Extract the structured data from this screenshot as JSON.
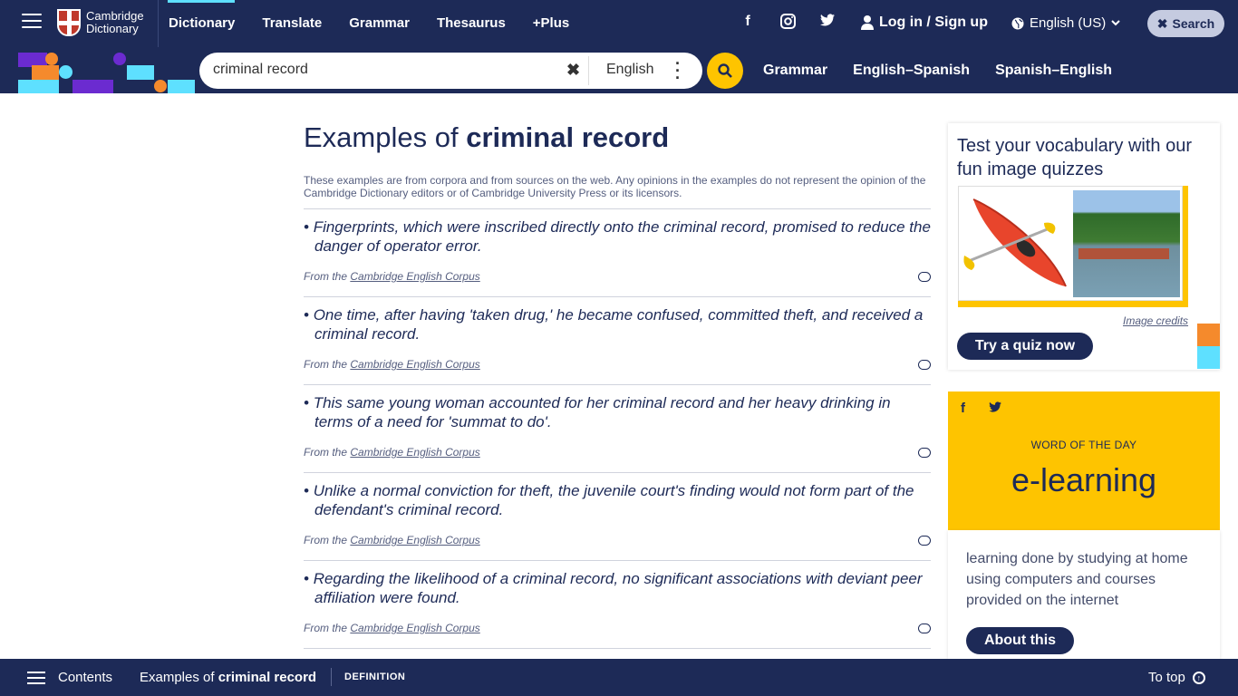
{
  "header": {
    "logo_line1": "Cambridge",
    "logo_line2": "Dictionary",
    "nav": [
      "Dictionary",
      "Translate",
      "Grammar",
      "Thesaurus",
      "+Plus"
    ],
    "login_label": "Log in / Sign up",
    "language_label": "English (US)",
    "search_label": "Search"
  },
  "searchbar": {
    "query": "criminal record",
    "dictionary_lang": "English",
    "subnav": [
      "Grammar",
      "English–Spanish",
      "Spanish–English"
    ]
  },
  "main": {
    "title_prefix": "Examples of",
    "title_term": "criminal record",
    "intro": "These examples are from corpora and from sources on the web. Any opinions in the examples do not represent the opinion of the Cambridge Dictionary editors or of Cambridge University Press or its licensors.",
    "source_prefix": "From the",
    "source_name": "Cambridge English Corpus",
    "examples": [
      "Fingerprints, which were inscribed directly onto the criminal record, promised to reduce the danger of operator error.",
      "One time, after having 'taken drug,' he became confused, committed theft, and received a criminal record.",
      "This same young woman accounted for her criminal record and her heavy drinking in terms of a need for 'summat to do'.",
      "Unlike a normal conviction for theft, the juvenile court's finding would not form part of the defendant's criminal record.",
      "Regarding the likelihood of a criminal record, no significant associations with deviant peer affiliation were found."
    ]
  },
  "quiz": {
    "title": "Test your vocabulary with our fun image quizzes",
    "credits": "Image credits",
    "button": "Try a quiz now"
  },
  "wotd": {
    "label": "WORD OF THE DAY",
    "word": "e-learning",
    "definition": "learning done by studying at home using computers and courses provided on the internet",
    "button": "About this"
  },
  "bottombar": {
    "contents": "Contents",
    "examples_prefix": "Examples of",
    "examples_term": "criminal record",
    "definition": "DEFINITION",
    "to_top": "To top"
  },
  "colors": {
    "navy": "#1d2a57",
    "yellow": "#fec400",
    "cyan": "#5ee0ff",
    "purple": "#6b2bd0",
    "orange": "#f58a2c"
  }
}
